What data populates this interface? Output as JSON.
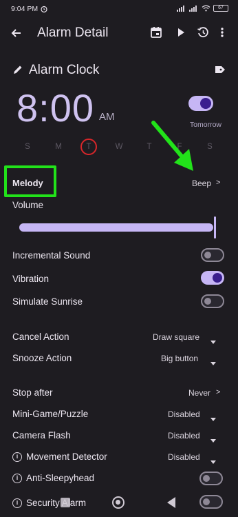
{
  "status_bar": {
    "time": "9:04 PM",
    "battery": "67"
  },
  "app_bar": {
    "title": "Alarm Detail"
  },
  "alarm": {
    "name": "Alarm Clock",
    "time": "8:00",
    "ampm": "AM",
    "enabled": true,
    "next": "Tomorrow",
    "days": [
      {
        "label": "S",
        "today": false
      },
      {
        "label": "M",
        "today": false
      },
      {
        "label": "T",
        "today": true
      },
      {
        "label": "W",
        "today": false
      },
      {
        "label": "T",
        "today": false
      },
      {
        "label": "F",
        "today": false
      },
      {
        "label": "S",
        "today": false
      }
    ]
  },
  "settings": {
    "melody": {
      "label": "Melody",
      "value": "Beep",
      "chevron": ">"
    },
    "volume": {
      "label": "Volume",
      "level": 1.0
    },
    "incremental_sound": {
      "label": "Incremental Sound",
      "on": false
    },
    "vibration": {
      "label": "Vibration",
      "on": true
    },
    "simulate_sunrise": {
      "label": "Simulate Sunrise",
      "on": false
    },
    "cancel_action": {
      "label": "Cancel Action",
      "value": "Draw square"
    },
    "snooze_action": {
      "label": "Snooze Action",
      "value": "Big button"
    },
    "stop_after": {
      "label": "Stop after",
      "value": "Never",
      "chevron": ">"
    },
    "mini_game": {
      "label": "Mini-Game/Puzzle",
      "value": "Disabled"
    },
    "camera_flash": {
      "label": "Camera Flash",
      "value": "Disabled"
    },
    "movement_detector": {
      "label": "Movement Detector",
      "value": "Disabled"
    },
    "anti_sleepyhead": {
      "label": "Anti-Sleepyhead",
      "on": false
    },
    "security_alarm": {
      "label": "Security Alarm",
      "on": false
    }
  },
  "colors": {
    "accent": "#c6b6f5",
    "annotation": "#22e21a",
    "today_ring": "#d8262a",
    "background": "#1e1c21"
  }
}
